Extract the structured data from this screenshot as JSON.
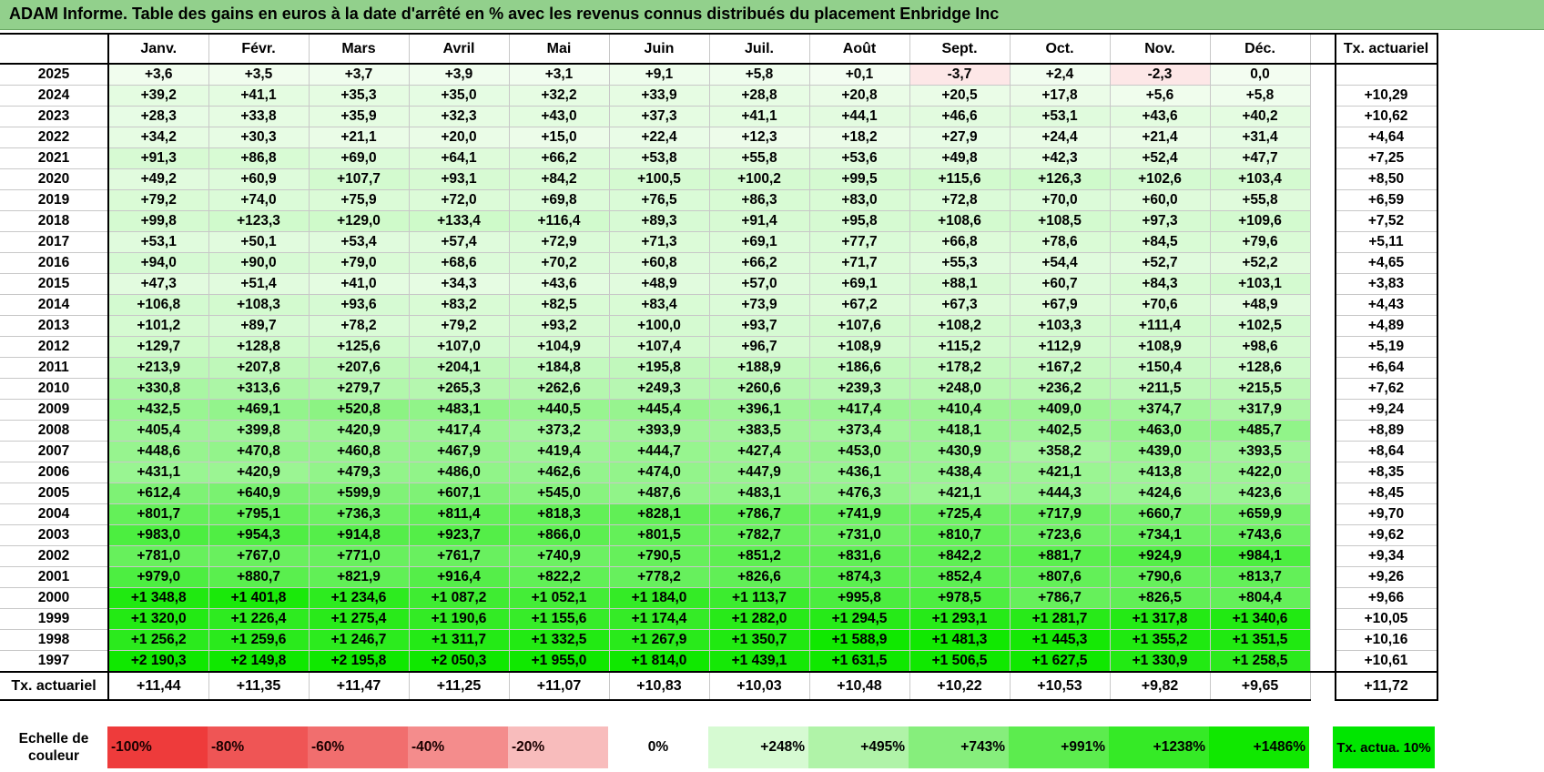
{
  "title": "ADAM Informe. Table des gains en euros à la date d'arrêté en % avec les revenus connus distribués du placement Enbridge Inc",
  "months": [
    "Janv.",
    "Févr.",
    "Mars",
    "Avril",
    "Mai",
    "Juin",
    "Juil.",
    "Août",
    "Sept.",
    "Oct.",
    "Nov.",
    "Déc."
  ],
  "tx_header": "Tx. actuariel",
  "rows": [
    {
      "year": "2025",
      "values": [
        "+3,6",
        "+3,5",
        "+3,7",
        "+3,9",
        "+3,1",
        "+9,1",
        "+5,8",
        "+0,1",
        "-3,7",
        "+2,4",
        "-2,3",
        "0,0"
      ],
      "tx": ""
    },
    {
      "year": "2024",
      "values": [
        "+39,2",
        "+41,1",
        "+35,3",
        "+35,0",
        "+32,2",
        "+33,9",
        "+28,8",
        "+20,8",
        "+20,5",
        "+17,8",
        "+5,6",
        "+5,8"
      ],
      "tx": "+10,29"
    },
    {
      "year": "2023",
      "values": [
        "+28,3",
        "+33,8",
        "+35,9",
        "+32,3",
        "+43,0",
        "+37,3",
        "+41,1",
        "+44,1",
        "+46,6",
        "+53,1",
        "+43,6",
        "+40,2"
      ],
      "tx": "+10,62"
    },
    {
      "year": "2022",
      "values": [
        "+34,2",
        "+30,3",
        "+21,1",
        "+20,0",
        "+15,0",
        "+22,4",
        "+12,3",
        "+18,2",
        "+27,9",
        "+24,4",
        "+21,4",
        "+31,4"
      ],
      "tx": "+4,64"
    },
    {
      "year": "2021",
      "values": [
        "+91,3",
        "+86,8",
        "+69,0",
        "+64,1",
        "+66,2",
        "+53,8",
        "+55,8",
        "+53,6",
        "+49,8",
        "+42,3",
        "+52,4",
        "+47,7"
      ],
      "tx": "+7,25"
    },
    {
      "year": "2020",
      "values": [
        "+49,2",
        "+60,9",
        "+107,7",
        "+93,1",
        "+84,2",
        "+100,5",
        "+100,2",
        "+99,5",
        "+115,6",
        "+126,3",
        "+102,6",
        "+103,4"
      ],
      "tx": "+8,50"
    },
    {
      "year": "2019",
      "values": [
        "+79,2",
        "+74,0",
        "+75,9",
        "+72,0",
        "+69,8",
        "+76,5",
        "+86,3",
        "+83,0",
        "+72,8",
        "+70,0",
        "+60,0",
        "+55,8"
      ],
      "tx": "+6,59"
    },
    {
      "year": "2018",
      "values": [
        "+99,8",
        "+123,3",
        "+129,0",
        "+133,4",
        "+116,4",
        "+89,3",
        "+91,4",
        "+95,8",
        "+108,6",
        "+108,5",
        "+97,3",
        "+109,6"
      ],
      "tx": "+7,52"
    },
    {
      "year": "2017",
      "values": [
        "+53,1",
        "+50,1",
        "+53,4",
        "+57,4",
        "+72,9",
        "+71,3",
        "+69,1",
        "+77,7",
        "+66,8",
        "+78,6",
        "+84,5",
        "+79,6"
      ],
      "tx": "+5,11"
    },
    {
      "year": "2016",
      "values": [
        "+94,0",
        "+90,0",
        "+79,0",
        "+68,6",
        "+70,2",
        "+60,8",
        "+66,2",
        "+71,7",
        "+55,3",
        "+54,4",
        "+52,7",
        "+52,2"
      ],
      "tx": "+4,65"
    },
    {
      "year": "2015",
      "values": [
        "+47,3",
        "+51,4",
        "+41,0",
        "+34,3",
        "+43,6",
        "+48,9",
        "+57,0",
        "+69,1",
        "+88,1",
        "+60,7",
        "+84,3",
        "+103,1"
      ],
      "tx": "+3,83"
    },
    {
      "year": "2014",
      "values": [
        "+106,8",
        "+108,3",
        "+93,6",
        "+83,2",
        "+82,5",
        "+83,4",
        "+73,9",
        "+67,2",
        "+67,3",
        "+67,9",
        "+70,6",
        "+48,9"
      ],
      "tx": "+4,43"
    },
    {
      "year": "2013",
      "values": [
        "+101,2",
        "+89,7",
        "+78,2",
        "+79,2",
        "+93,2",
        "+100,0",
        "+93,7",
        "+107,6",
        "+108,2",
        "+103,3",
        "+111,4",
        "+102,5"
      ],
      "tx": "+4,89"
    },
    {
      "year": "2012",
      "values": [
        "+129,7",
        "+128,8",
        "+125,6",
        "+107,0",
        "+104,9",
        "+107,4",
        "+96,7",
        "+108,9",
        "+115,2",
        "+112,9",
        "+108,9",
        "+98,6"
      ],
      "tx": "+5,19"
    },
    {
      "year": "2011",
      "values": [
        "+213,9",
        "+207,8",
        "+207,6",
        "+204,1",
        "+184,8",
        "+195,8",
        "+188,9",
        "+186,6",
        "+178,2",
        "+167,2",
        "+150,4",
        "+128,6"
      ],
      "tx": "+6,64"
    },
    {
      "year": "2010",
      "values": [
        "+330,8",
        "+313,6",
        "+279,7",
        "+265,3",
        "+262,6",
        "+249,3",
        "+260,6",
        "+239,3",
        "+248,0",
        "+236,2",
        "+211,5",
        "+215,5"
      ],
      "tx": "+7,62"
    },
    {
      "year": "2009",
      "values": [
        "+432,5",
        "+469,1",
        "+520,8",
        "+483,1",
        "+440,5",
        "+445,4",
        "+396,1",
        "+417,4",
        "+410,4",
        "+409,0",
        "+374,7",
        "+317,9"
      ],
      "tx": "+9,24"
    },
    {
      "year": "2008",
      "values": [
        "+405,4",
        "+399,8",
        "+420,9",
        "+417,4",
        "+373,2",
        "+393,9",
        "+383,5",
        "+373,4",
        "+418,1",
        "+402,5",
        "+463,0",
        "+485,7"
      ],
      "tx": "+8,89"
    },
    {
      "year": "2007",
      "values": [
        "+448,6",
        "+470,8",
        "+460,8",
        "+467,9",
        "+419,4",
        "+444,7",
        "+427,4",
        "+453,0",
        "+430,9",
        "+358,2",
        "+439,0",
        "+393,5"
      ],
      "tx": "+8,64"
    },
    {
      "year": "2006",
      "values": [
        "+431,1",
        "+420,9",
        "+479,3",
        "+486,0",
        "+462,6",
        "+474,0",
        "+447,9",
        "+436,1",
        "+438,4",
        "+421,1",
        "+413,8",
        "+422,0"
      ],
      "tx": "+8,35"
    },
    {
      "year": "2005",
      "values": [
        "+612,4",
        "+640,9",
        "+599,9",
        "+607,1",
        "+545,0",
        "+487,6",
        "+483,1",
        "+476,3",
        "+421,1",
        "+444,3",
        "+424,6",
        "+423,6"
      ],
      "tx": "+8,45"
    },
    {
      "year": "2004",
      "values": [
        "+801,7",
        "+795,1",
        "+736,3",
        "+811,4",
        "+818,3",
        "+828,1",
        "+786,7",
        "+741,9",
        "+725,4",
        "+717,9",
        "+660,7",
        "+659,9"
      ],
      "tx": "+9,70"
    },
    {
      "year": "2003",
      "values": [
        "+983,0",
        "+954,3",
        "+914,8",
        "+923,7",
        "+866,0",
        "+801,5",
        "+782,7",
        "+731,0",
        "+810,7",
        "+723,6",
        "+734,1",
        "+743,6"
      ],
      "tx": "+9,62"
    },
    {
      "year": "2002",
      "values": [
        "+781,0",
        "+767,0",
        "+771,0",
        "+761,7",
        "+740,9",
        "+790,5",
        "+851,2",
        "+831,6",
        "+842,2",
        "+881,7",
        "+924,9",
        "+984,1"
      ],
      "tx": "+9,34"
    },
    {
      "year": "2001",
      "values": [
        "+979,0",
        "+880,7",
        "+821,9",
        "+916,4",
        "+822,2",
        "+778,2",
        "+826,6",
        "+874,3",
        "+852,4",
        "+807,6",
        "+790,6",
        "+813,7"
      ],
      "tx": "+9,26"
    },
    {
      "year": "2000",
      "values": [
        "+1 348,8",
        "+1 401,8",
        "+1 234,6",
        "+1 087,2",
        "+1 052,1",
        "+1 184,0",
        "+1 113,7",
        "+995,8",
        "+978,5",
        "+786,7",
        "+826,5",
        "+804,4"
      ],
      "tx": "+9,66"
    },
    {
      "year": "1999",
      "values": [
        "+1 320,0",
        "+1 226,4",
        "+1 275,4",
        "+1 190,6",
        "+1 155,6",
        "+1 174,4",
        "+1 282,0",
        "+1 294,5",
        "+1 293,1",
        "+1 281,7",
        "+1 317,8",
        "+1 340,6"
      ],
      "tx": "+10,05"
    },
    {
      "year": "1998",
      "values": [
        "+1 256,2",
        "+1 259,6",
        "+1 246,7",
        "+1 311,7",
        "+1 332,5",
        "+1 267,9",
        "+1 350,7",
        "+1 588,9",
        "+1 481,3",
        "+1 445,3",
        "+1 355,2",
        "+1 351,5"
      ],
      "tx": "+10,16"
    },
    {
      "year": "1997",
      "values": [
        "+2 190,3",
        "+2 149,8",
        "+2 195,8",
        "+2 050,3",
        "+1 955,0",
        "+1 814,0",
        "+1 439,1",
        "+1 631,5",
        "+1 506,5",
        "+1 627,5",
        "+1 330,9",
        "+1 258,5"
      ],
      "tx": "+10,61"
    }
  ],
  "footer": {
    "label": "Tx. actuariel",
    "values": [
      "+11,44",
      "+11,35",
      "+11,47",
      "+11,25",
      "+11,07",
      "+10,83",
      "+10,03",
      "+10,48",
      "+10,22",
      "+10,53",
      "+9,82",
      "+9,65"
    ],
    "total": "+11,72"
  },
  "scale": {
    "label": "Echelle de couleur",
    "items": [
      {
        "label": "-100%",
        "color": "#ee3b3b"
      },
      {
        "label": "-80%",
        "color": "#ef5555"
      },
      {
        "label": "-60%",
        "color": "#f16e6e"
      },
      {
        "label": "-40%",
        "color": "#f48c8c"
      },
      {
        "label": "-20%",
        "color": "#f8bcbc"
      },
      {
        "label": "0%",
        "color": "#ffffff"
      },
      {
        "label": "+248%",
        "color": "#d6fad2"
      },
      {
        "label": "+495%",
        "color": "#b0f3a8"
      },
      {
        "label": "+743%",
        "color": "#86ee7c"
      },
      {
        "label": "+991%",
        "color": "#5cec4e"
      },
      {
        "label": "+1238%",
        "color": "#35ea26"
      },
      {
        "label": "+1486%",
        "color": "#10e800"
      }
    ],
    "tx_label": "Tx. actua. 10%",
    "tx_color": "#00e600"
  }
}
